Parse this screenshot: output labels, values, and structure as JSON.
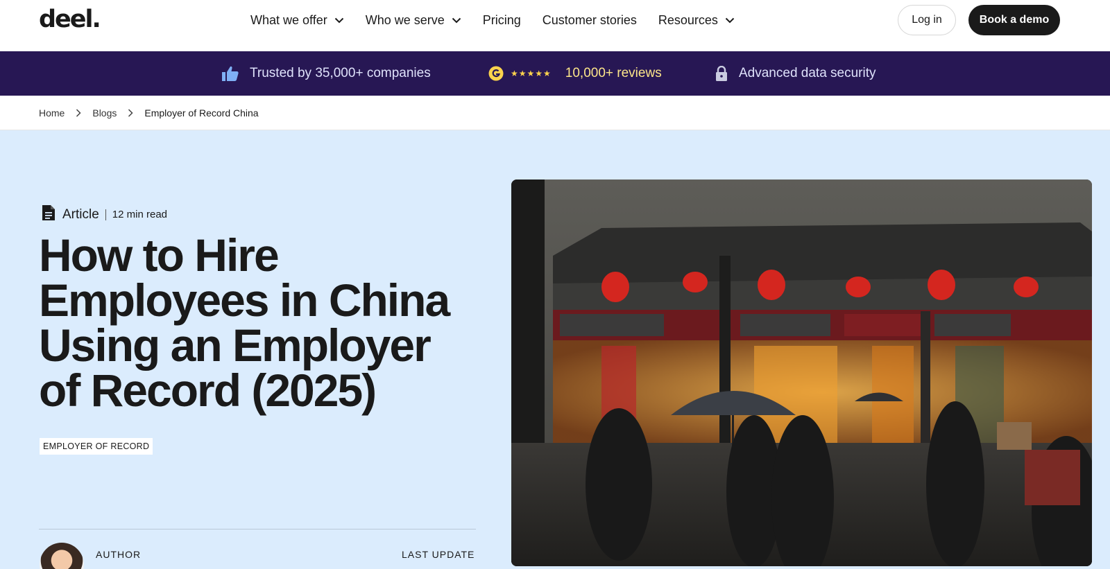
{
  "nav": {
    "logo": "deel.",
    "menu": [
      {
        "label": "What we offer",
        "has_dropdown": true
      },
      {
        "label": "Who we serve",
        "has_dropdown": true
      },
      {
        "label": "Pricing",
        "has_dropdown": false
      },
      {
        "label": "Customer stories",
        "has_dropdown": false
      },
      {
        "label": "Resources",
        "has_dropdown": true
      }
    ],
    "login_label": "Log in",
    "demo_label": "Book a demo"
  },
  "trust_bar": {
    "companies": "Trusted by 35,000+ companies",
    "rating_stars": "★★★★★",
    "reviews": "10,000+ reviews",
    "security": "Advanced data security"
  },
  "breadcrumb": [
    "Home",
    "Blogs",
    "Employer of Record China"
  ],
  "article": {
    "type": "Article",
    "read_time": "12 min read",
    "title": "How to Hire Employees in China Using an Employer of Record (2025)",
    "tag": "EMPLOYER OF RECORD",
    "author_label": "AUTHOR",
    "update_label": "LAST UPDATE"
  },
  "colors": {
    "trust_bar_bg": "#271754",
    "hero_bg": "#dbecfd",
    "primary_button": "#1a1a1a",
    "star_color": "#fcd34d"
  }
}
